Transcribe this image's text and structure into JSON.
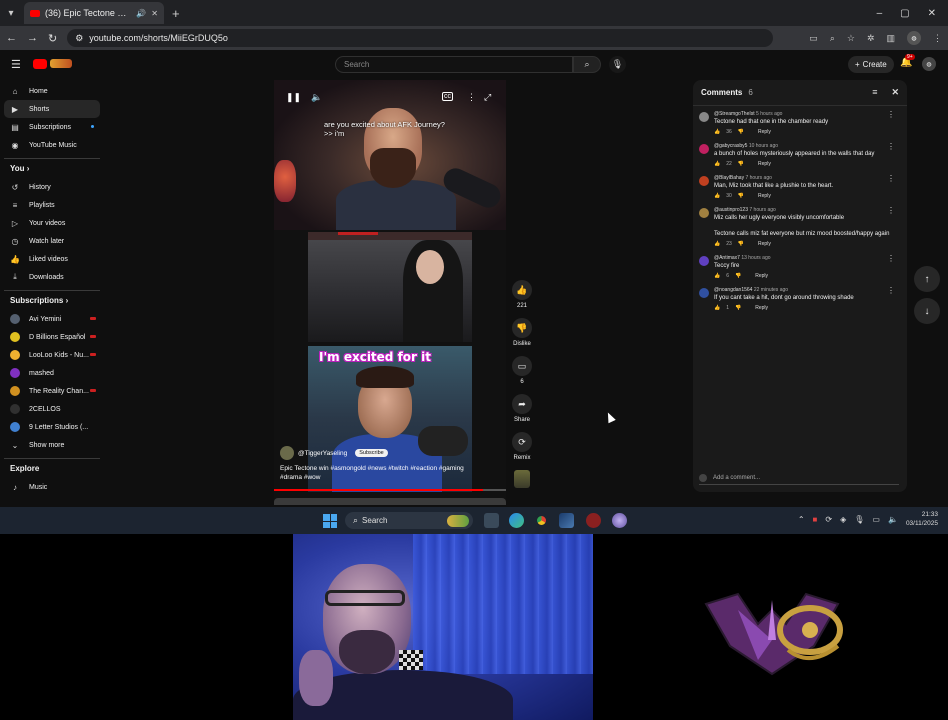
{
  "browser": {
    "tab_title": "(36) Epic Tectone win #asmo",
    "url": "youtube.com/shorts/MiiEGrDUQ5o",
    "new_tab": "+",
    "minimize": "–",
    "maximize": "▢",
    "close": "✕"
  },
  "youtube": {
    "search_placeholder": "Search",
    "create_label": "Create",
    "notification_count": "9+",
    "sidebar": {
      "main": [
        {
          "label": "Home",
          "icon": "home-icon",
          "glyph": "⌂"
        },
        {
          "label": "Shorts",
          "icon": "shorts-icon",
          "glyph": "▶"
        },
        {
          "label": "Subscriptions",
          "icon": "subscriptions-icon",
          "glyph": "▤"
        },
        {
          "label": "YouTube Music",
          "icon": "music-icon",
          "glyph": "◉"
        }
      ],
      "you_title": "You",
      "you": [
        {
          "label": "History",
          "icon": "history-icon",
          "glyph": "↺"
        },
        {
          "label": "Playlists",
          "icon": "playlists-icon",
          "glyph": "≡"
        },
        {
          "label": "Your videos",
          "icon": "your-videos-icon",
          "glyph": "▷"
        },
        {
          "label": "Watch later",
          "icon": "watch-later-icon",
          "glyph": "◷"
        },
        {
          "label": "Liked videos",
          "icon": "liked-videos-icon",
          "glyph": "👍"
        },
        {
          "label": "Downloads",
          "icon": "downloads-icon",
          "glyph": "⤓"
        }
      ],
      "subscriptions_title": "Subscriptions",
      "subscriptions": [
        {
          "label": "Avi Yemini",
          "color": "#556070",
          "live": true
        },
        {
          "label": "D Billions Español",
          "color": "#e0c020",
          "live": true
        },
        {
          "label": "LooLoo Kids - Nu...",
          "color": "#f0b030",
          "live": true
        },
        {
          "label": "mashed",
          "color": "#8030c0",
          "live": false
        },
        {
          "label": "The Reality Chan...",
          "color": "#d09020",
          "live": true
        },
        {
          "label": "2CELLOS",
          "color": "#303030",
          "live": false
        },
        {
          "label": "9 Letter Studios (...",
          "color": "#4080d0",
          "live": false
        }
      ],
      "show_more": "Show more",
      "explore_title": "Explore",
      "explore": [
        {
          "label": "Music",
          "icon": "music-note-icon",
          "glyph": "♪"
        }
      ]
    },
    "short": {
      "caption": "are you excited about AFK Journey? >> i'm",
      "overlay_text": "I'm excited for it",
      "channel": "@TiggerYaseling",
      "subscribe": "Subscribe",
      "description": "Epic Tectone win #asmongold #news #twitch #reaction #gaming #drama #wow",
      "progress": 0.9
    },
    "actions": {
      "like_count": "221",
      "dislike_label": "Dislike",
      "comments_count": "6",
      "share_label": "Share",
      "remix_label": "Remix"
    },
    "comments": {
      "title": "Comments",
      "count": "6",
      "add_placeholder": "Add a comment...",
      "items": [
        {
          "author": "@StreamgoTheIst",
          "time": "5 hours ago",
          "text": "Tectone had that one in the chamber ready",
          "likes": "36",
          "reply": "Reply",
          "color": "#888"
        },
        {
          "author": "@gabycrasby5",
          "time": "10 hours ago",
          "text": "a bunch of holes mysteriously appeared in the walls that day",
          "likes": "22",
          "reply": "Reply",
          "color": "#c02060"
        },
        {
          "author": "@BlaylBahay",
          "time": "7 hours ago",
          "text": "Man, Miz took that like a plushie to the heart.",
          "likes": "30",
          "reply": "Reply",
          "color": "#c04020"
        },
        {
          "author": "@austinpro123",
          "time": "7 hours ago",
          "text": "Miz calls her ugly everyone visibly uncomfortable\n\nTectone calls miz fat everyone but miz mood boosted/happy again",
          "likes": "23",
          "reply": "Reply",
          "color": "#a08040"
        },
        {
          "author": "@Antimax7",
          "time": "13 hours ago",
          "text": "Teccy fire",
          "likes": "6",
          "reply": "Reply",
          "color": "#6040c0"
        },
        {
          "author": "@noangdan1564",
          "time": "22 minutes ago",
          "text": "If you cant take a hit, dont go around throwing shade",
          "likes": "1",
          "reply": "Reply",
          "color": "#3050a0"
        }
      ]
    }
  },
  "taskbar": {
    "search_label": "Search",
    "time": "21:33",
    "date": "03/11/2025"
  }
}
